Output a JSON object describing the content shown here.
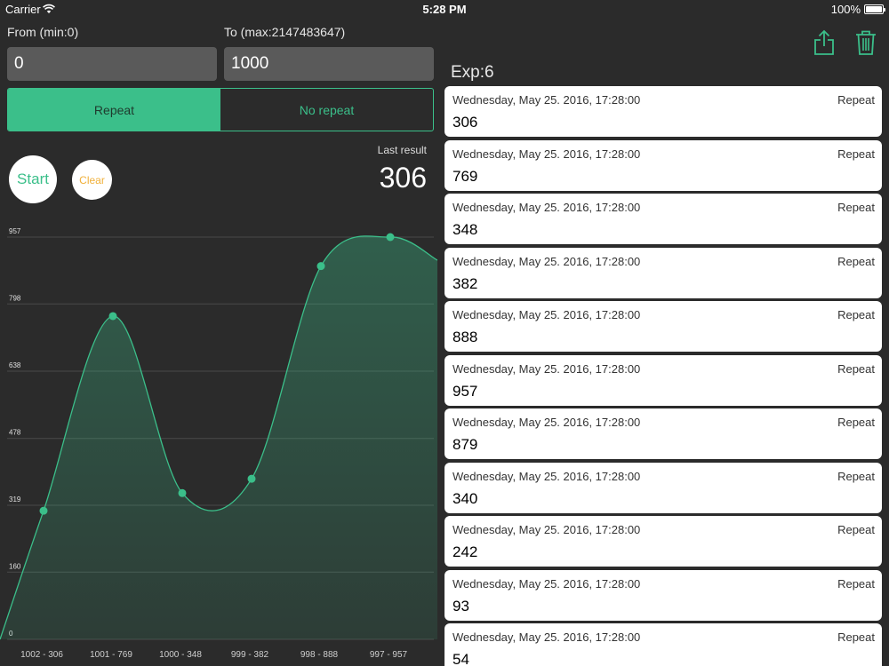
{
  "status": {
    "carrier": "Carrier",
    "time": "5:28 PM",
    "battery": "100%"
  },
  "range": {
    "from_label": "From (min:0)",
    "from_value": "0",
    "to_label": "To (max:2147483647)",
    "to_value": "1000"
  },
  "mode": {
    "repeat_label": "Repeat",
    "no_repeat_label": "No repeat",
    "selected": "Repeat"
  },
  "result": {
    "last_label": "Last result",
    "last_value": "306"
  },
  "buttons": {
    "start": "Start",
    "clear": "Clear"
  },
  "colors": {
    "accent": "#3bbf8a",
    "clear": "#f0b03a",
    "background": "#2b2b2b"
  },
  "chart_data": {
    "type": "area",
    "categories": [
      "1002 - 306",
      "1001 - 769",
      "1000 - 348",
      "999 - 382",
      "998 - 888",
      "997 - 957"
    ],
    "values": [
      306,
      769,
      348,
      382,
      888,
      957
    ],
    "yticks": [
      "0",
      "160",
      "319",
      "478",
      "638",
      "798",
      "957"
    ],
    "ylim": [
      0,
      957
    ],
    "grid": true
  },
  "history": {
    "title": "Exp:6",
    "share_icon": "share-icon",
    "trash_icon": "trash-icon",
    "items": [
      {
        "date": "Wednesday, May 25. 2016, 17:28:00",
        "kind": "Repeat",
        "value": "306"
      },
      {
        "date": "Wednesday, May 25. 2016, 17:28:00",
        "kind": "Repeat",
        "value": "769"
      },
      {
        "date": "Wednesday, May 25. 2016, 17:28:00",
        "kind": "Repeat",
        "value": "348"
      },
      {
        "date": "Wednesday, May 25. 2016, 17:28:00",
        "kind": "Repeat",
        "value": "382"
      },
      {
        "date": "Wednesday, May 25. 2016, 17:28:00",
        "kind": "Repeat",
        "value": "888"
      },
      {
        "date": "Wednesday, May 25. 2016, 17:28:00",
        "kind": "Repeat",
        "value": "957"
      },
      {
        "date": "Wednesday, May 25. 2016, 17:28:00",
        "kind": "Repeat",
        "value": "879"
      },
      {
        "date": "Wednesday, May 25. 2016, 17:28:00",
        "kind": "Repeat",
        "value": "340"
      },
      {
        "date": "Wednesday, May 25. 2016, 17:28:00",
        "kind": "Repeat",
        "value": "242"
      },
      {
        "date": "Wednesday, May 25. 2016, 17:28:00",
        "kind": "Repeat",
        "value": "93"
      },
      {
        "date": "Wednesday, May 25. 2016, 17:28:00",
        "kind": "Repeat",
        "value": "54"
      }
    ]
  }
}
